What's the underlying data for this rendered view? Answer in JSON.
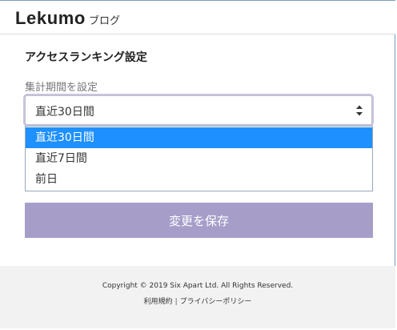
{
  "header": {
    "brand": "Lekumo",
    "brand_sub": "ブログ"
  },
  "main": {
    "title": "アクセスランキング設定",
    "period_label": "集計期間を設定",
    "period_select": {
      "value": "直近30日間",
      "options": [
        "直近30日間",
        "直近7日間",
        "前日"
      ],
      "highlighted_index": 0
    },
    "save_label": "変更を保存"
  },
  "footer": {
    "copyright": "Copyright © 2019 Six Apart Ltd. All Rights Reserved.",
    "links": [
      "利用規約",
      "プライバシーポリシー"
    ],
    "separator": "|"
  },
  "colors": {
    "accent_button": "#a69ec9",
    "option_highlight": "#1e90ff",
    "footer_bg": "#f2f2f2"
  }
}
